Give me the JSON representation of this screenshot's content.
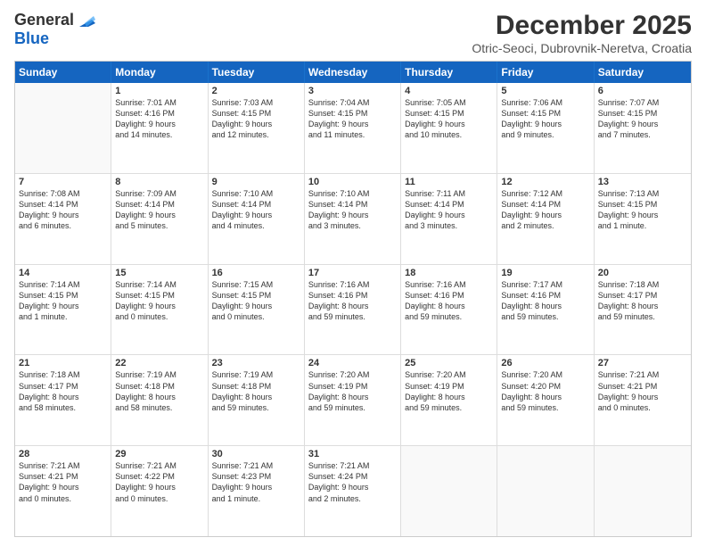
{
  "logo": {
    "general": "General",
    "blue": "Blue"
  },
  "header": {
    "title": "December 2025",
    "subtitle": "Otric-Seoci, Dubrovnik-Neretva, Croatia"
  },
  "weekdays": [
    "Sunday",
    "Monday",
    "Tuesday",
    "Wednesday",
    "Thursday",
    "Friday",
    "Saturday"
  ],
  "rows": [
    [
      {
        "day": "",
        "lines": []
      },
      {
        "day": "1",
        "lines": [
          "Sunrise: 7:01 AM",
          "Sunset: 4:16 PM",
          "Daylight: 9 hours",
          "and 14 minutes."
        ]
      },
      {
        "day": "2",
        "lines": [
          "Sunrise: 7:03 AM",
          "Sunset: 4:15 PM",
          "Daylight: 9 hours",
          "and 12 minutes."
        ]
      },
      {
        "day": "3",
        "lines": [
          "Sunrise: 7:04 AM",
          "Sunset: 4:15 PM",
          "Daylight: 9 hours",
          "and 11 minutes."
        ]
      },
      {
        "day": "4",
        "lines": [
          "Sunrise: 7:05 AM",
          "Sunset: 4:15 PM",
          "Daylight: 9 hours",
          "and 10 minutes."
        ]
      },
      {
        "day": "5",
        "lines": [
          "Sunrise: 7:06 AM",
          "Sunset: 4:15 PM",
          "Daylight: 9 hours",
          "and 9 minutes."
        ]
      },
      {
        "day": "6",
        "lines": [
          "Sunrise: 7:07 AM",
          "Sunset: 4:15 PM",
          "Daylight: 9 hours",
          "and 7 minutes."
        ]
      }
    ],
    [
      {
        "day": "7",
        "lines": [
          "Sunrise: 7:08 AM",
          "Sunset: 4:14 PM",
          "Daylight: 9 hours",
          "and 6 minutes."
        ]
      },
      {
        "day": "8",
        "lines": [
          "Sunrise: 7:09 AM",
          "Sunset: 4:14 PM",
          "Daylight: 9 hours",
          "and 5 minutes."
        ]
      },
      {
        "day": "9",
        "lines": [
          "Sunrise: 7:10 AM",
          "Sunset: 4:14 PM",
          "Daylight: 9 hours",
          "and 4 minutes."
        ]
      },
      {
        "day": "10",
        "lines": [
          "Sunrise: 7:10 AM",
          "Sunset: 4:14 PM",
          "Daylight: 9 hours",
          "and 3 minutes."
        ]
      },
      {
        "day": "11",
        "lines": [
          "Sunrise: 7:11 AM",
          "Sunset: 4:14 PM",
          "Daylight: 9 hours",
          "and 3 minutes."
        ]
      },
      {
        "day": "12",
        "lines": [
          "Sunrise: 7:12 AM",
          "Sunset: 4:14 PM",
          "Daylight: 9 hours",
          "and 2 minutes."
        ]
      },
      {
        "day": "13",
        "lines": [
          "Sunrise: 7:13 AM",
          "Sunset: 4:15 PM",
          "Daylight: 9 hours",
          "and 1 minute."
        ]
      }
    ],
    [
      {
        "day": "14",
        "lines": [
          "Sunrise: 7:14 AM",
          "Sunset: 4:15 PM",
          "Daylight: 9 hours",
          "and 1 minute."
        ]
      },
      {
        "day": "15",
        "lines": [
          "Sunrise: 7:14 AM",
          "Sunset: 4:15 PM",
          "Daylight: 9 hours",
          "and 0 minutes."
        ]
      },
      {
        "day": "16",
        "lines": [
          "Sunrise: 7:15 AM",
          "Sunset: 4:15 PM",
          "Daylight: 9 hours",
          "and 0 minutes."
        ]
      },
      {
        "day": "17",
        "lines": [
          "Sunrise: 7:16 AM",
          "Sunset: 4:16 PM",
          "Daylight: 8 hours",
          "and 59 minutes."
        ]
      },
      {
        "day": "18",
        "lines": [
          "Sunrise: 7:16 AM",
          "Sunset: 4:16 PM",
          "Daylight: 8 hours",
          "and 59 minutes."
        ]
      },
      {
        "day": "19",
        "lines": [
          "Sunrise: 7:17 AM",
          "Sunset: 4:16 PM",
          "Daylight: 8 hours",
          "and 59 minutes."
        ]
      },
      {
        "day": "20",
        "lines": [
          "Sunrise: 7:18 AM",
          "Sunset: 4:17 PM",
          "Daylight: 8 hours",
          "and 59 minutes."
        ]
      }
    ],
    [
      {
        "day": "21",
        "lines": [
          "Sunrise: 7:18 AM",
          "Sunset: 4:17 PM",
          "Daylight: 8 hours",
          "and 58 minutes."
        ]
      },
      {
        "day": "22",
        "lines": [
          "Sunrise: 7:19 AM",
          "Sunset: 4:18 PM",
          "Daylight: 8 hours",
          "and 58 minutes."
        ]
      },
      {
        "day": "23",
        "lines": [
          "Sunrise: 7:19 AM",
          "Sunset: 4:18 PM",
          "Daylight: 8 hours",
          "and 59 minutes."
        ]
      },
      {
        "day": "24",
        "lines": [
          "Sunrise: 7:20 AM",
          "Sunset: 4:19 PM",
          "Daylight: 8 hours",
          "and 59 minutes."
        ]
      },
      {
        "day": "25",
        "lines": [
          "Sunrise: 7:20 AM",
          "Sunset: 4:19 PM",
          "Daylight: 8 hours",
          "and 59 minutes."
        ]
      },
      {
        "day": "26",
        "lines": [
          "Sunrise: 7:20 AM",
          "Sunset: 4:20 PM",
          "Daylight: 8 hours",
          "and 59 minutes."
        ]
      },
      {
        "day": "27",
        "lines": [
          "Sunrise: 7:21 AM",
          "Sunset: 4:21 PM",
          "Daylight: 9 hours",
          "and 0 minutes."
        ]
      }
    ],
    [
      {
        "day": "28",
        "lines": [
          "Sunrise: 7:21 AM",
          "Sunset: 4:21 PM",
          "Daylight: 9 hours",
          "and 0 minutes."
        ]
      },
      {
        "day": "29",
        "lines": [
          "Sunrise: 7:21 AM",
          "Sunset: 4:22 PM",
          "Daylight: 9 hours",
          "and 0 minutes."
        ]
      },
      {
        "day": "30",
        "lines": [
          "Sunrise: 7:21 AM",
          "Sunset: 4:23 PM",
          "Daylight: 9 hours",
          "and 1 minute."
        ]
      },
      {
        "day": "31",
        "lines": [
          "Sunrise: 7:21 AM",
          "Sunset: 4:24 PM",
          "Daylight: 9 hours",
          "and 2 minutes."
        ]
      },
      {
        "day": "",
        "lines": []
      },
      {
        "day": "",
        "lines": []
      },
      {
        "day": "",
        "lines": []
      }
    ]
  ]
}
